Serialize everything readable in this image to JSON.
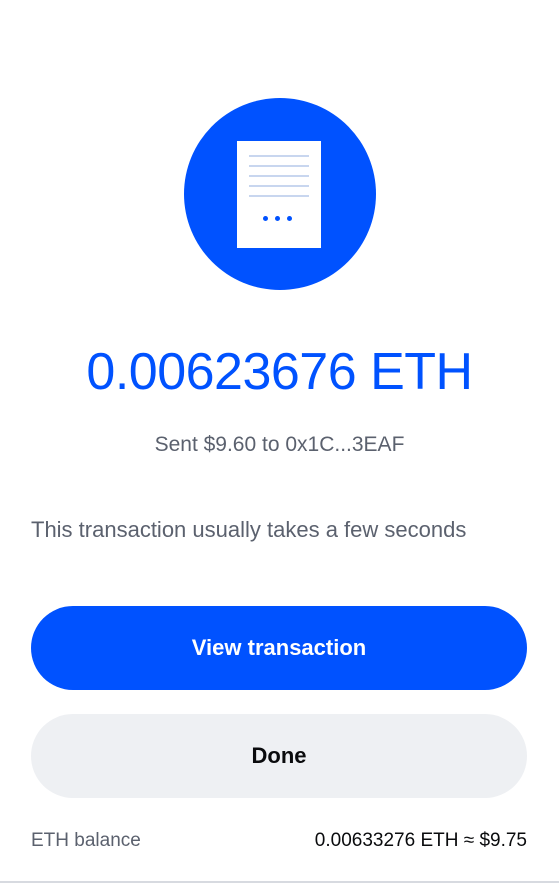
{
  "colors": {
    "accent": "#0052ff",
    "secondary_button_bg": "#eef0f3",
    "muted_text": "#5b616e",
    "dark_text": "#0a0b0d"
  },
  "hero": {
    "icon": "document-icon"
  },
  "transaction": {
    "amount": "0.00623676 ETH",
    "sent_text": "Sent $9.60 to 0x1C...3EAF",
    "info_text": "This transaction usually takes a few seconds"
  },
  "actions": {
    "view_transaction_label": "View transaction",
    "done_label": "Done"
  },
  "balance": {
    "label": "ETH balance",
    "value": "0.00633276 ETH ≈ $9.75"
  }
}
